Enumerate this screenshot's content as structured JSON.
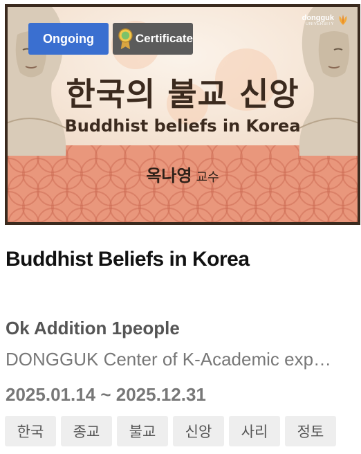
{
  "thumbnail": {
    "title_ko": "한국의 불교 신앙",
    "title_en": "Buddhist beliefs in Korea",
    "professor_name": "옥나영",
    "professor_title": "교수",
    "logo_main": "dongguk",
    "logo_sub": "UNIVERSITY"
  },
  "badges": {
    "status": "Ongoing",
    "certificate": "Certificate"
  },
  "course": {
    "title": "Buddhist Beliefs in Korea",
    "enrollment": "Ok Addition 1people",
    "institution": "DONGGUK Center of K-Academic exp…",
    "period": "2025.01.14 ~ 2025.12.31"
  },
  "tags": [
    "한국",
    "종교",
    "불교",
    "신앙",
    "사리",
    "정토"
  ],
  "colors": {
    "ongoing": "#3a6fd0",
    "certificate": "#5b5b5b",
    "band": "#e9977c",
    "frame": "#3a2a1e"
  }
}
